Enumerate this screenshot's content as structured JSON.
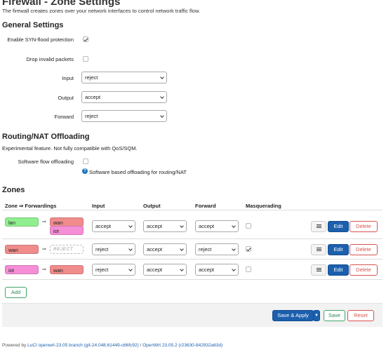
{
  "page": {
    "title": "Firewall - Zone Settings",
    "description": "The firewall creates zones over your network interfaces to control network traffic flow."
  },
  "general": {
    "heading": "General Settings",
    "syn_flood_label": "Enable SYN-flood protection",
    "syn_flood_checked": true,
    "drop_invalid_label": "Drop invalid packets",
    "drop_invalid_checked": false,
    "input_label": "Input",
    "input_value": "reject",
    "output_label": "Output",
    "output_value": "accept",
    "forward_label": "Forward",
    "forward_value": "reject"
  },
  "offloading": {
    "heading": "Routing/NAT Offloading",
    "description": "Experimental feature. Not fully compatible with QoS/SQM.",
    "sw_flow_label": "Software flow offloading",
    "sw_flow_checked": false,
    "help_text": "Software based offloading for routing/NAT"
  },
  "zones": {
    "heading": "Zones",
    "columns": {
      "zone": "Zone ⇒ Forwardings",
      "input": "Input",
      "output": "Output",
      "forward": "Forward",
      "masq": "Masquerading"
    },
    "rows": [
      {
        "zone": "lan",
        "forwards": [
          "wan",
          "iot"
        ],
        "input": "accept",
        "output": "accept",
        "forward": "accept",
        "masq": false
      },
      {
        "zone": "wan",
        "forwards": [
          "REJECT"
        ],
        "input": "reject",
        "output": "accept",
        "forward": "reject",
        "masq": true
      },
      {
        "zone": "iot",
        "forwards": [
          "wan"
        ],
        "input": "reject",
        "output": "accept",
        "forward": "accept",
        "masq": false
      }
    ],
    "edit_label": "Edit",
    "delete_label": "Delete",
    "add_label": "Add"
  },
  "colors": {
    "lan": "#90ee90",
    "wan": "#f08c8c",
    "iot": "#f58ed6",
    "primary": "#1c5fad"
  },
  "actions": {
    "save_apply": "Save & Apply",
    "save": "Save",
    "reset": "Reset"
  },
  "footer": {
    "prefix": "Powered by ",
    "luci": "LuCI openwrt-23.05 branch (git-24.048.61449-c66fc92)",
    "sep": " / ",
    "openwrt": "OpenWrt 23.05.2 (r23630-842932a63d)"
  }
}
